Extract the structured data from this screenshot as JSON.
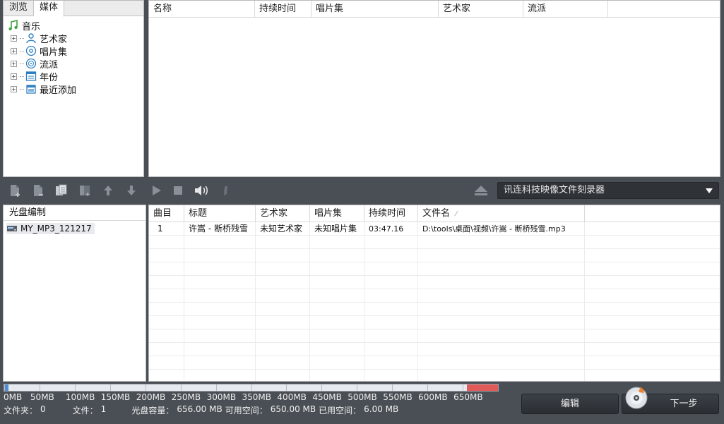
{
  "library": {
    "tabs": [
      "浏览",
      "媒体"
    ],
    "active_tab": 1,
    "tree": {
      "root": "音乐",
      "items": [
        {
          "label": "艺术家",
          "icon": "artist-icon"
        },
        {
          "label": "唱片集",
          "icon": "album-icon"
        },
        {
          "label": "流派",
          "icon": "genre-icon"
        },
        {
          "label": "年份",
          "icon": "calendar-icon"
        },
        {
          "label": "最近添加",
          "icon": "recent-icon"
        }
      ]
    },
    "columns": [
      "名称",
      "持续时间",
      "唱片集",
      "艺术家",
      "流派"
    ]
  },
  "toolbar": {
    "icons": [
      "add-file-icon",
      "add-folder-icon",
      "copy-icon",
      "remove-icon",
      "move-up-icon",
      "move-down-icon",
      "play-icon",
      "stop-icon",
      "volume-icon",
      "edit-pen-icon"
    ],
    "eject_icon": "eject-icon",
    "burner": "讯连科技映像文件刻录器"
  },
  "disc": {
    "header": "光盘编制",
    "item": "MY_MP3_121217"
  },
  "tracks": {
    "columns": [
      "曲目",
      "标题",
      "艺术家",
      "唱片集",
      "持续时间",
      "文件名"
    ],
    "rows": [
      {
        "track": "1",
        "title": "许嵩 - 断桥残雪",
        "artist": "未知艺术家",
        "album": "未知唱片集",
        "duration": "03:47.16",
        "file": "D:\\tools\\桌面\\视频\\许嵩 - 断桥残雪.mp3"
      }
    ]
  },
  "capacity": {
    "scale_labels": [
      "0MB",
      "50MB",
      "100MB",
      "150MB",
      "200MB",
      "250MB",
      "300MB",
      "350MB",
      "400MB",
      "450MB",
      "500MB",
      "550MB",
      "600MB",
      "650MB"
    ],
    "used_mb": 6.0,
    "scale_max_mb": 700,
    "capacity_mb": 656.0,
    "colors": {
      "used": "#4a8fd8",
      "over": "#e05a5a",
      "free": "#e6e9ee"
    }
  },
  "status": {
    "folders_label": "文件夹：",
    "folders_value": "0",
    "files_label": "文件：",
    "files_value": "1",
    "capacity_label": "光盘容量：",
    "capacity_value": "656.00 MB",
    "available_label": "可用空间：",
    "available_value": "650.00 MB",
    "used_label": "已用空间：",
    "used_value": "6.00 MB"
  },
  "buttons": {
    "edit": "编辑",
    "next": "下一步"
  }
}
